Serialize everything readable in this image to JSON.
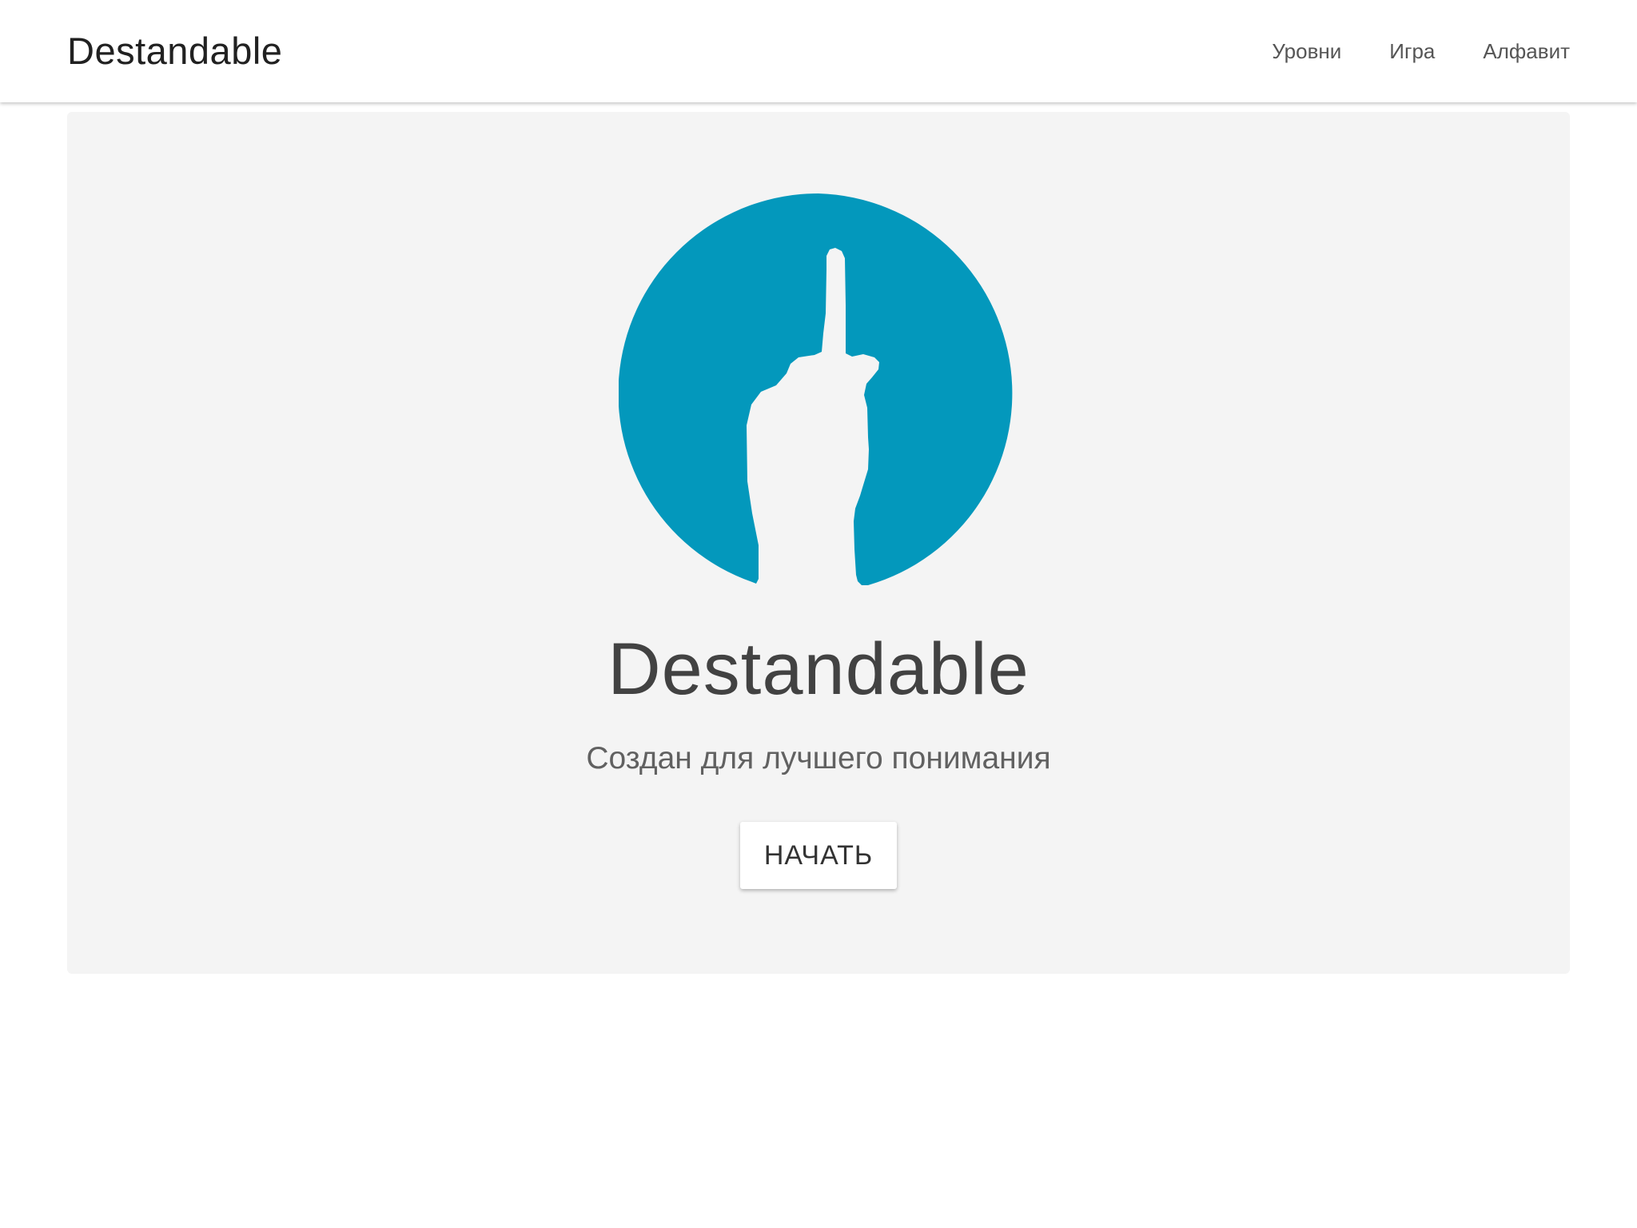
{
  "navbar": {
    "brand": "Destandable",
    "links": [
      {
        "label": "Уровни"
      },
      {
        "label": "Игра"
      },
      {
        "label": "Алфавит"
      }
    ]
  },
  "hero": {
    "logo_icon": "raised-index-finger-hand-icon",
    "title": "Destandable",
    "subtitle": "Создан для лучшего понимания",
    "start_button": "НАЧАТЬ"
  },
  "colors": {
    "logo_circle": "#0398bc",
    "hero_background": "#f4f4f4",
    "navbar_background": "#ffffff",
    "title_text": "#424242",
    "subtitle_text": "#616161"
  }
}
